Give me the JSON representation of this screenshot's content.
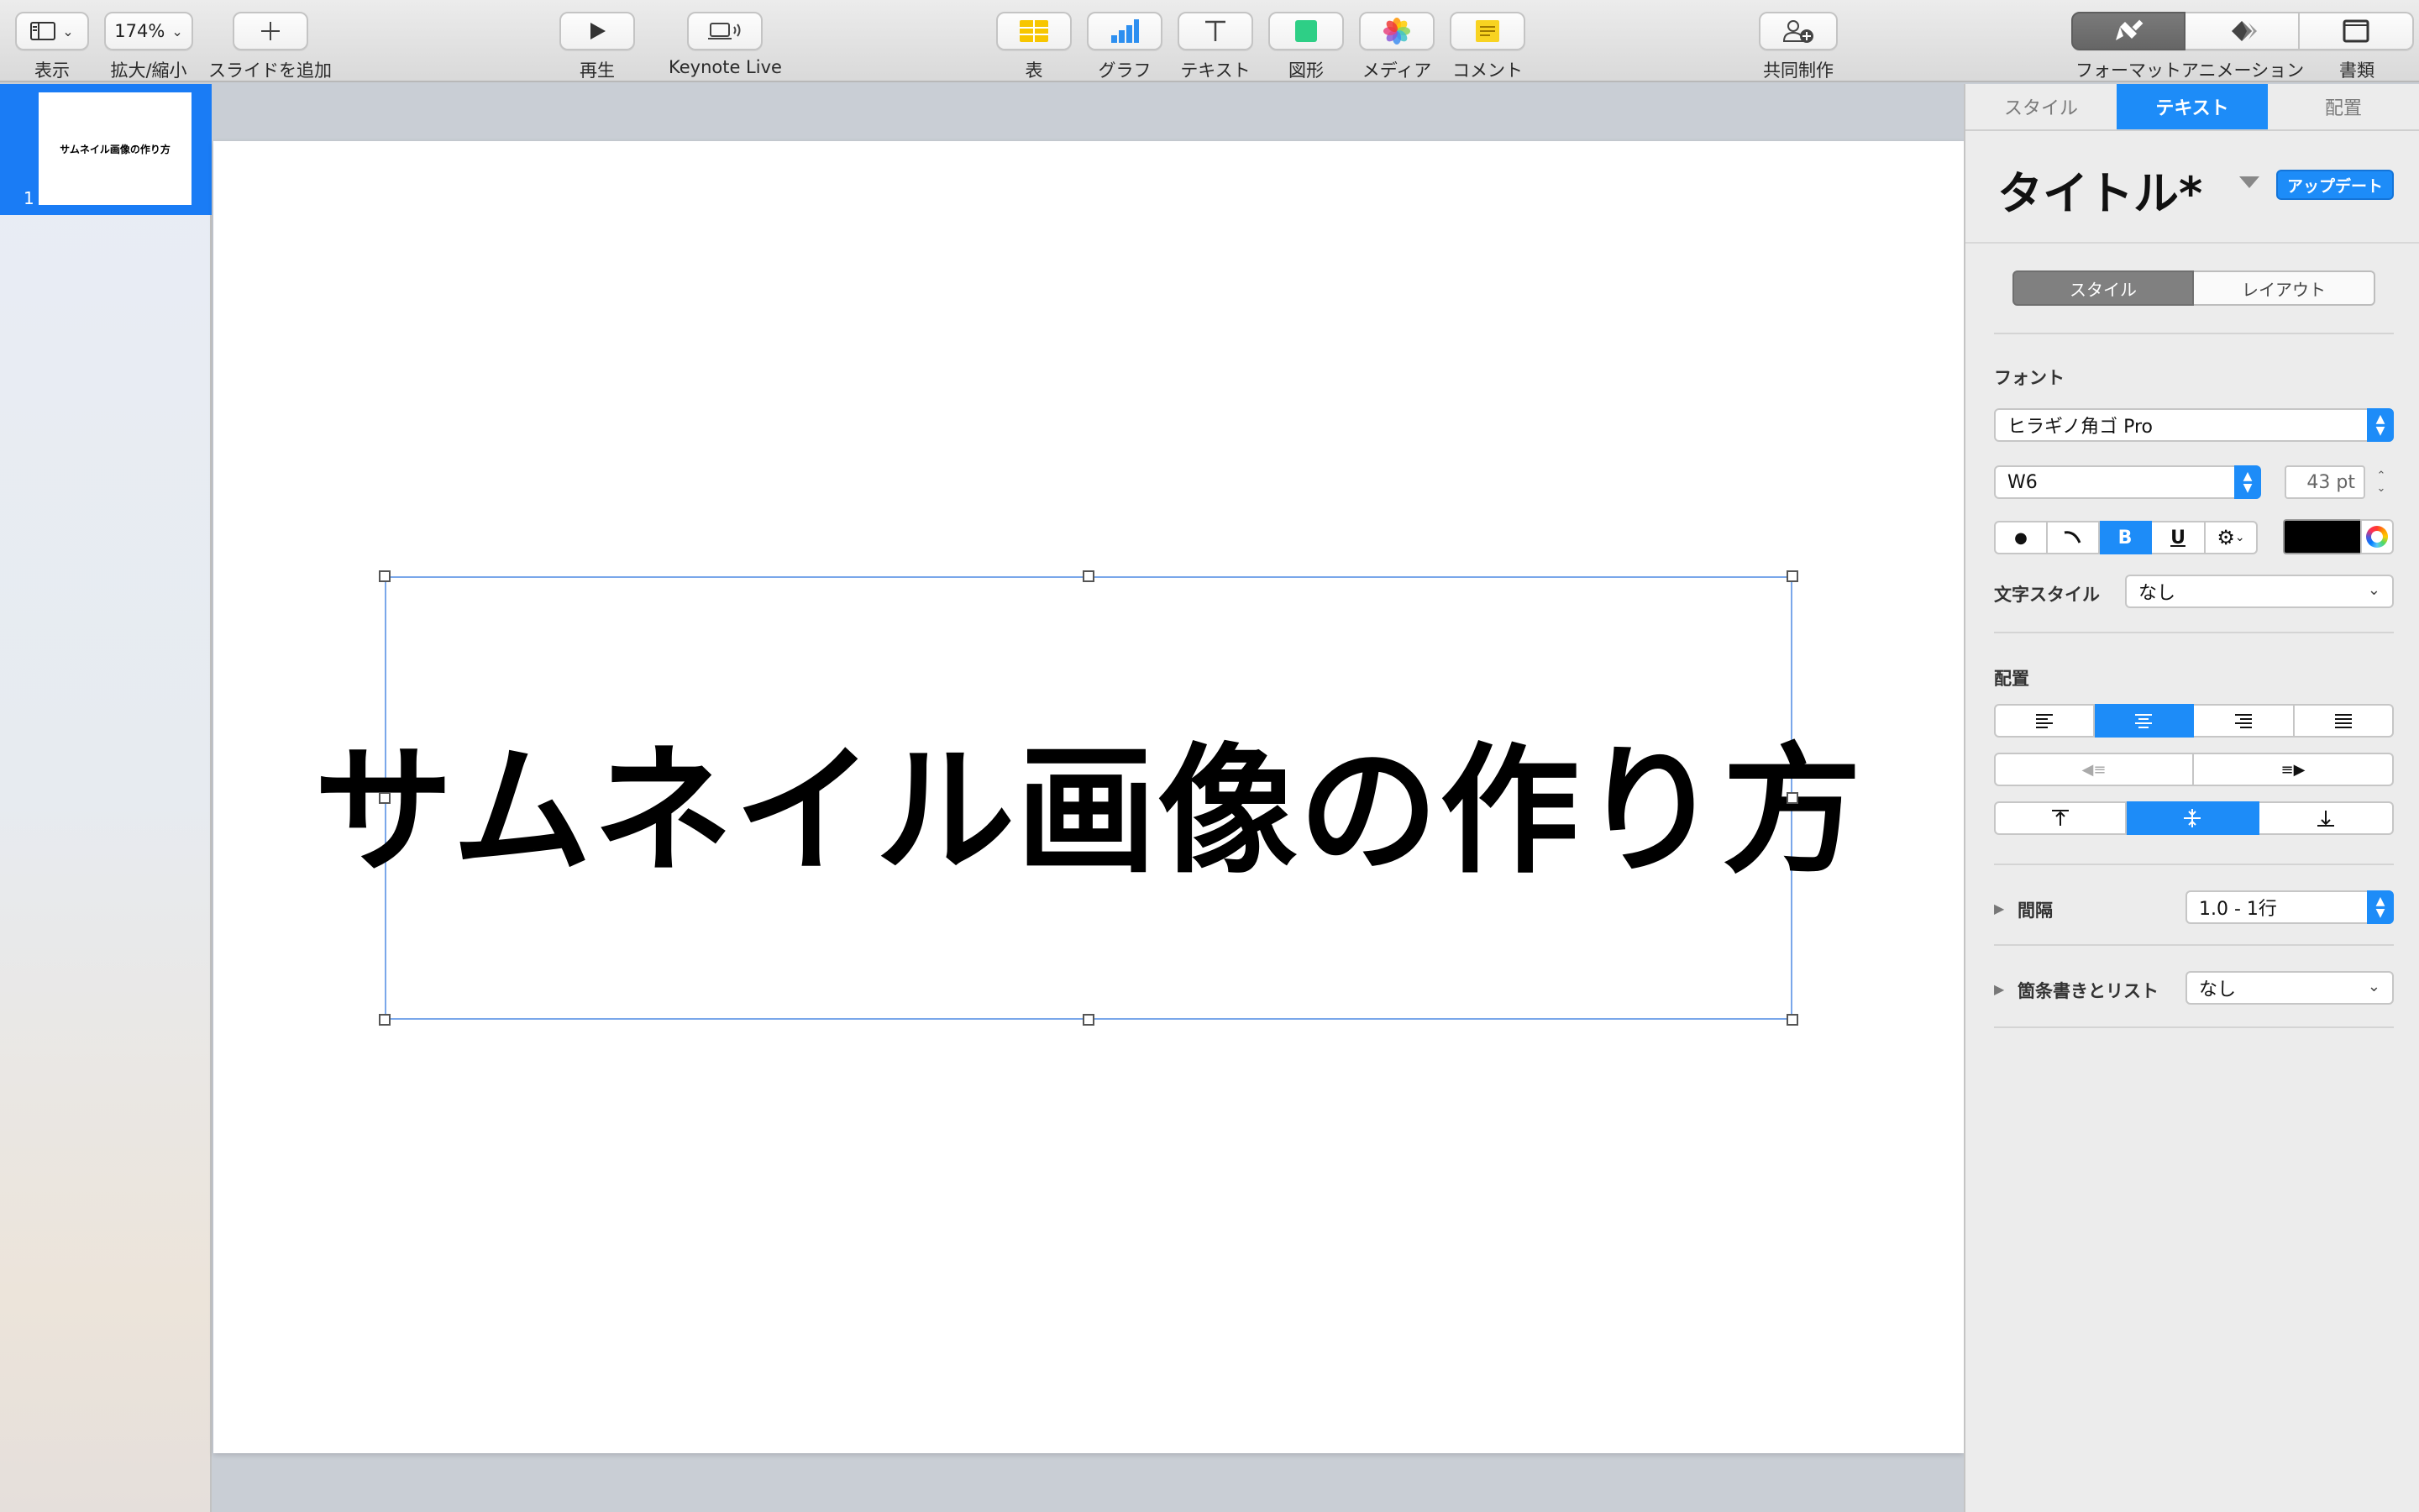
{
  "toolbar": {
    "view": {
      "label": "表示",
      "icon": "sidebar-view-icon"
    },
    "zoom": {
      "label": "拡大/縮小",
      "value": "174%"
    },
    "add_slide": {
      "label": "スライドを追加",
      "icon": "plus-icon"
    },
    "play": {
      "label": "再生",
      "icon": "play-icon"
    },
    "keynote_live": {
      "label": "Keynote Live",
      "icon": "keynote-live-icon"
    },
    "table": {
      "label": "表",
      "icon": "table-icon",
      "color": "#f7c600"
    },
    "chart": {
      "label": "グラフ",
      "icon": "chart-icon",
      "color": "#2d8ff0"
    },
    "text": {
      "label": "テキスト",
      "icon": "text-icon"
    },
    "shape": {
      "label": "図形",
      "icon": "shape-icon",
      "color": "#2ecf86"
    },
    "media": {
      "label": "メディア",
      "icon": "photos-icon"
    },
    "comment": {
      "label": "コメント",
      "icon": "comment-icon",
      "color": "#f8d321"
    },
    "collaborate": {
      "label": "共同制作",
      "icon": "collaborate-icon"
    },
    "format": {
      "label": "フォーマット",
      "icon": "format-brush-icon"
    },
    "animate": {
      "label": "アニメーション",
      "icon": "animate-diamond-icon"
    },
    "document": {
      "label": "書類",
      "icon": "document-icon"
    }
  },
  "navigator": {
    "slides": [
      {
        "number": "1",
        "thumb_text": "サムネイル画像の作り方"
      }
    ]
  },
  "slide": {
    "title": "サムネイル画像の作り方"
  },
  "inspector": {
    "tabs": [
      "スタイル",
      "テキスト",
      "配置"
    ],
    "active_tab": "テキスト",
    "paragraph_style": "タイトル*",
    "update_button": "アップデート",
    "subtabs": [
      "スタイル",
      "レイアウト"
    ],
    "font_label": "フォント",
    "font_family": "ヒラギノ角ゴ Pro",
    "font_weight": "W6",
    "font_size": "43 pt",
    "bold": "B",
    "underline": "U",
    "char_style_label": "文字スタイル",
    "char_style_value": "なし",
    "alignment_label": "配置",
    "spacing_label": "間隔",
    "spacing_value": "1.0 - 1行",
    "bullets_label": "箇条書きとリスト",
    "bullets_value": "なし",
    "accent_color": "#1d8cf8",
    "text_color": "#000000"
  }
}
